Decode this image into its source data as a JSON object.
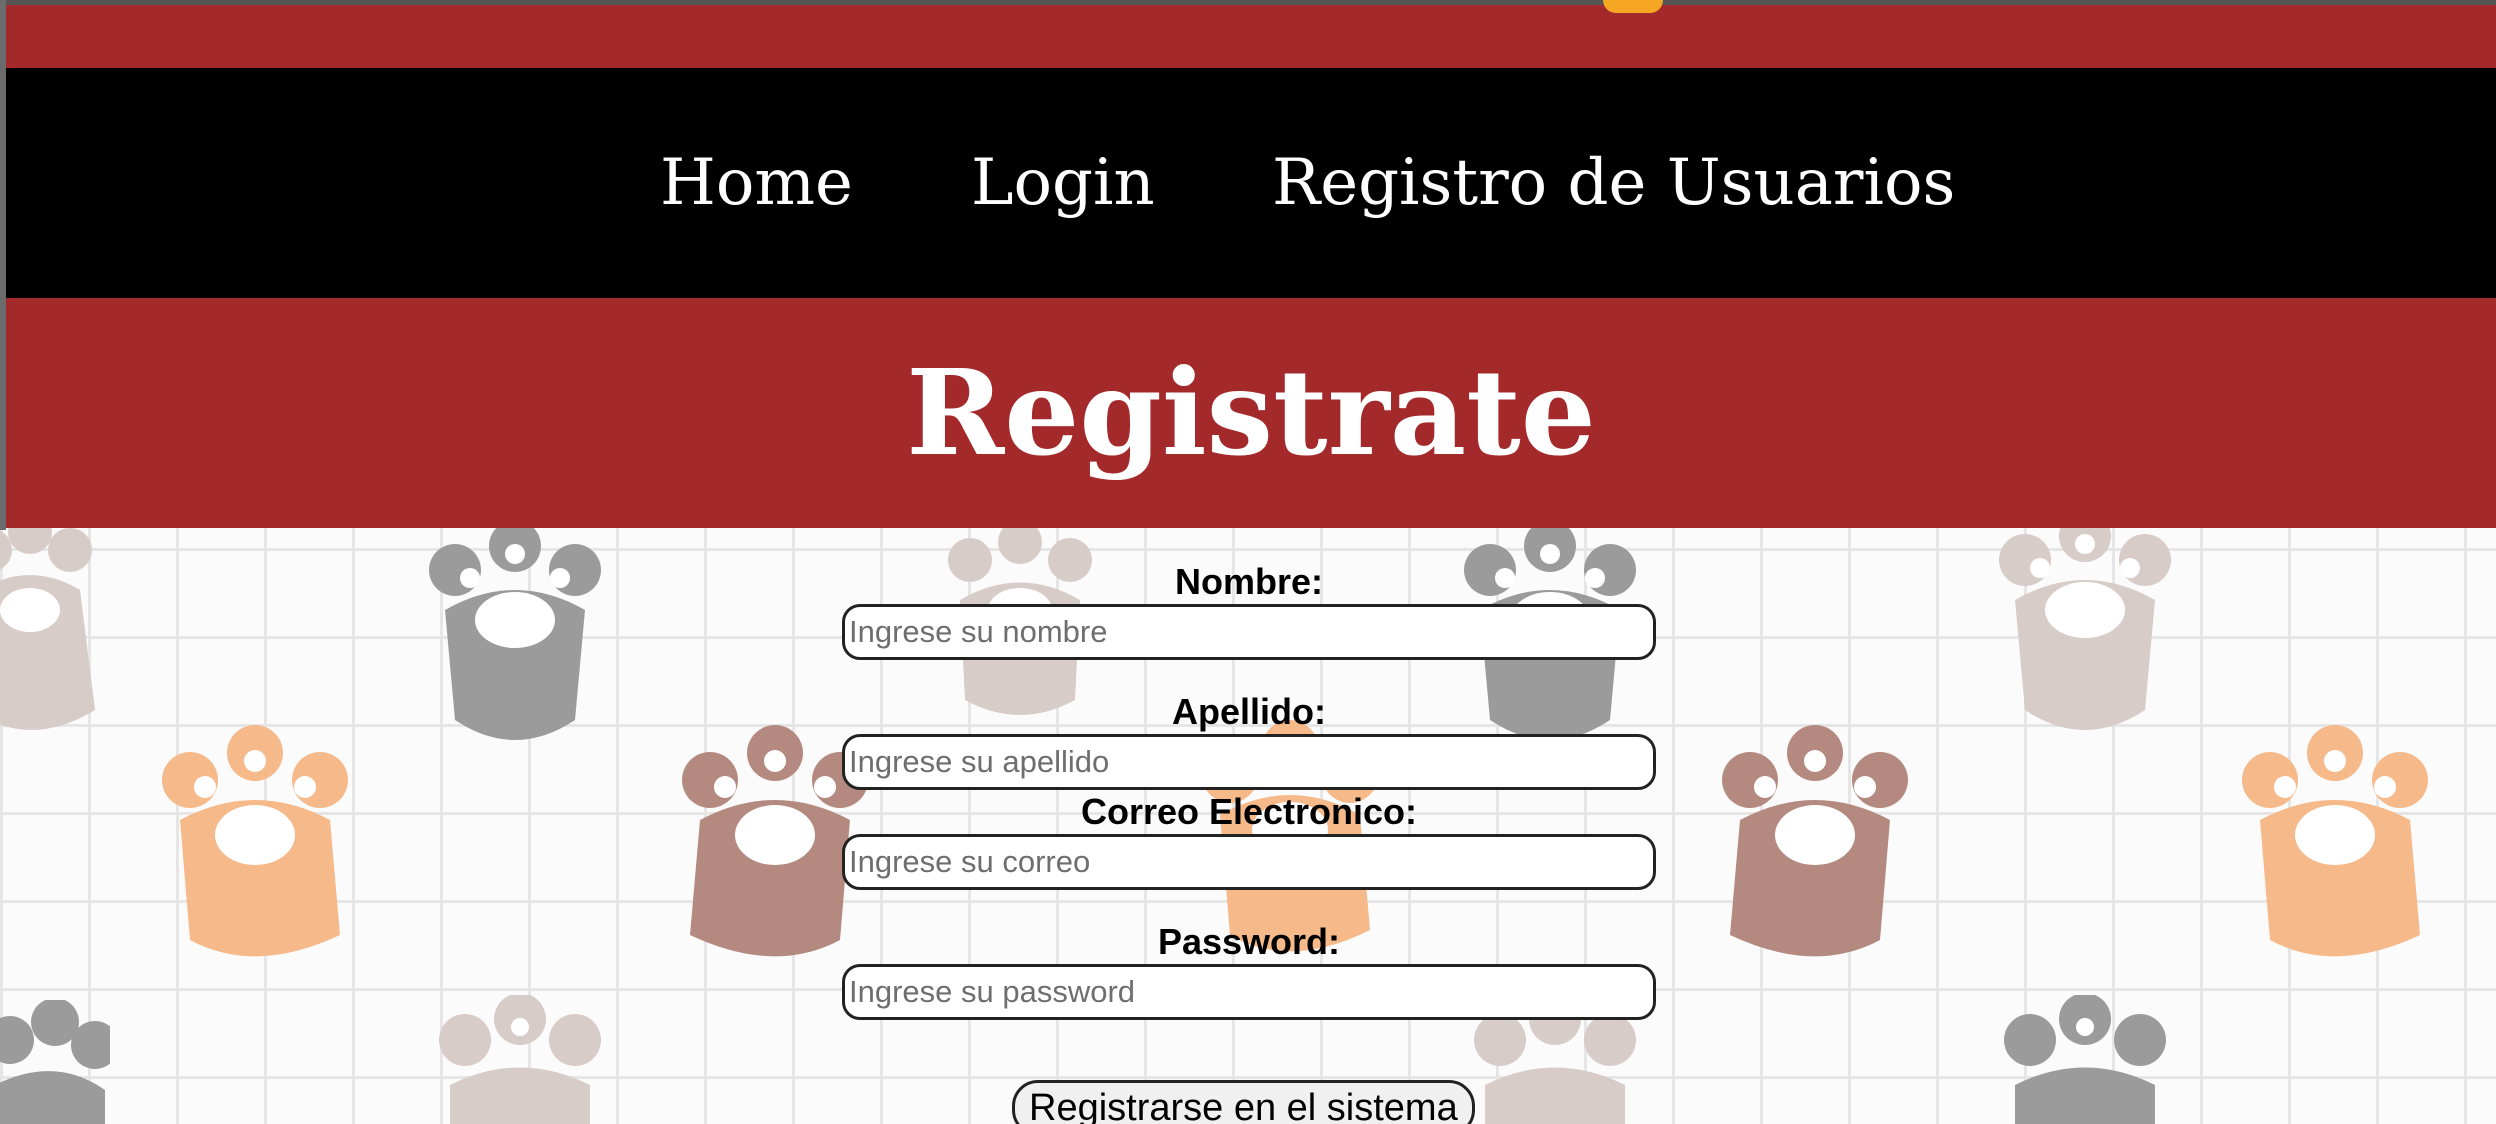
{
  "nav": {
    "items": [
      {
        "label": "Home"
      },
      {
        "label": "Login"
      },
      {
        "label": "Registro de Usuarios"
      }
    ]
  },
  "page": {
    "title": "Registrate"
  },
  "form": {
    "nombre": {
      "label": "Nombre:",
      "placeholder": "Ingrese su nombre"
    },
    "apellido": {
      "label": "Apellido:",
      "placeholder": "Ingrese su apellido"
    },
    "correo": {
      "label": "Correo Electronico:",
      "placeholder": "Ingrese su correo"
    },
    "password": {
      "label": "Password:",
      "placeholder": "Ingrese su password"
    },
    "submit_label": "Registrarse en el sistema"
  },
  "colors": {
    "header_red": "#a4292b",
    "nav_black": "#000000",
    "accent_orange": "#f5a623"
  },
  "background": {
    "pattern": "paw-print grid",
    "paw_colors": [
      "#9b9b9b",
      "#d8ccc8",
      "#f6b98a",
      "#b48a80"
    ]
  }
}
